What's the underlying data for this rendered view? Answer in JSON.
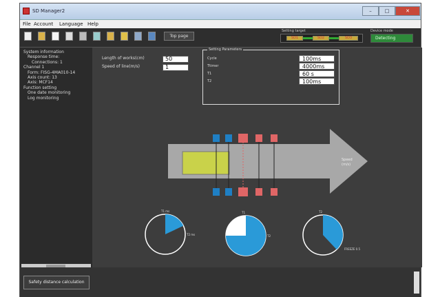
{
  "window": {
    "title": "SD Manager2"
  },
  "window_buttons": {
    "minimize": "–",
    "maximize": "□",
    "close": "✕"
  },
  "menu": [
    "File",
    "Account",
    "Language",
    "Help"
  ],
  "toolbar": {
    "top_page_label": "Top page",
    "icons": [
      "doc-icon",
      "db-icon",
      "save-icon",
      "list-icon",
      "grid-icon",
      "monitor-icon",
      "chart-icon",
      "bookmark-icon",
      "sensor-icon",
      "export-icon"
    ],
    "setting_target_label": "Setting target",
    "device_mode_label": "Device mode",
    "device_mode_value": "Detecting",
    "levels": [
      "SD1",
      "SD2",
      "SD3"
    ]
  },
  "sidebar": {
    "lines": [
      "System information",
      "Response time:",
      "Connections: 1",
      "Channel 1",
      "Form: FISG-4MA010-14",
      "Axis count: 13",
      "Axis: MCF14",
      "Function setting",
      "One date monitoring",
      "Log monitoring"
    ],
    "indent": [
      0,
      1,
      2,
      0,
      1,
      1,
      1,
      0,
      1,
      1
    ]
  },
  "params": {
    "length_label": "Length of works(cm)",
    "length_value": "50",
    "speed_label": "Speed of line(m/s)",
    "speed_value": "1"
  },
  "settings": {
    "title": "Setting Parameters",
    "rows": [
      {
        "label": "Cycle",
        "value": "100ms"
      },
      {
        "label": "Ttimer",
        "value": "4000ms"
      },
      {
        "label": "T1",
        "value": "60 s"
      },
      {
        "label": "T2",
        "value": "100ms"
      }
    ]
  },
  "diagram": {
    "arrow_label_1": "Speed",
    "arrow_label_2": "(m/s)"
  },
  "pies": [
    {
      "fraction": 0.18,
      "label_top": "T1 ms",
      "label_right": "T2 ms"
    },
    {
      "fraction": 0.75,
      "label_top": "T1",
      "label_right": "T2"
    },
    {
      "fraction": 0.38,
      "label_top": "T2",
      "label_right": "FREEZE 0.5"
    }
  ],
  "bottom": {
    "safety_button": "Safety distance calculation"
  },
  "colors": {
    "pie_fill": "#2a9ad8",
    "work_block": "#c9d24a",
    "sensor_blue": "#1f7fc4",
    "sensor_red": "#e06666",
    "device_mode_bg": "#2e8a3a"
  }
}
